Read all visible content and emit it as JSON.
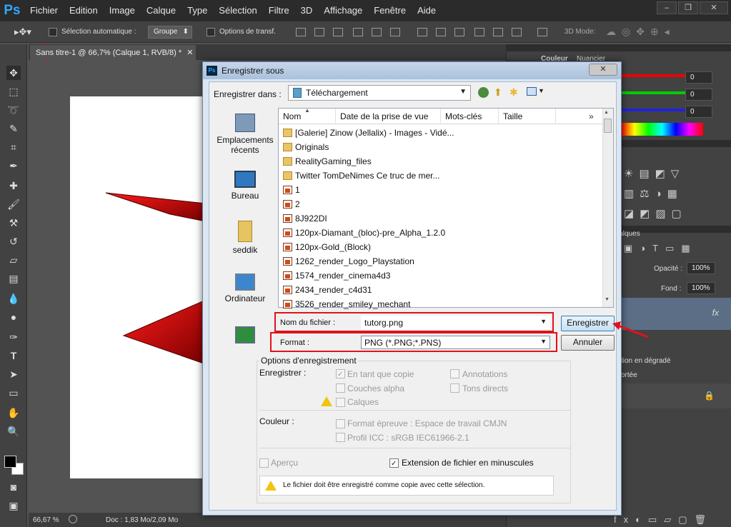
{
  "app": {
    "logo": "Ps"
  },
  "menu": [
    "Fichier",
    "Edition",
    "Image",
    "Calque",
    "Type",
    "Sélection",
    "Filtre",
    "3D",
    "Affichage",
    "Fenêtre",
    "Aide"
  ],
  "options": {
    "auto_select": "Sélection automatique :",
    "group": "Groupe",
    "transform": "Options de transf.",
    "mode3d": "3D Mode:"
  },
  "document": {
    "tab": "Sans titre-1 @ 66,7% (Calque 1, RVB/8) *",
    "zoom": "66,67 %",
    "doc_info": "Doc : 1,83 Mo/2,09 Mo"
  },
  "panels": {
    "color_tab": "Couleur",
    "swatches_tab": "Nuancier",
    "r": "0",
    "g": "0",
    "b": "0",
    "layers_tab": "Calques",
    "opacity_label": "Opacité :",
    "opacity_value": "100%",
    "fill_label": "Fond :",
    "fill_value": "100%",
    "fx": "fx",
    "effect1": "tion en dégradé",
    "effect2": "ortée"
  },
  "dialog": {
    "title": "Enregistrer sous",
    "save_in_label": "Enregistrer dans :",
    "save_in_value": "Téléchargement",
    "places": [
      "Emplacements récents",
      "Bureau",
      "seddik",
      "Ordinateur"
    ],
    "columns": [
      "Nom",
      "Date de la prise de vue",
      "Mots-clés",
      "Taille"
    ],
    "files": [
      {
        "name": "[Galerie] Zinow (Jellalix) - Images - Vidé...",
        "type": "folder"
      },
      {
        "name": "Originals",
        "type": "folder"
      },
      {
        "name": "RealityGaming_files",
        "type": "folder"
      },
      {
        "name": "Twitter   TomDeNimes   Ce truc de mer...",
        "type": "folder"
      },
      {
        "name": "1",
        "type": "img"
      },
      {
        "name": "2",
        "type": "img"
      },
      {
        "name": "8J922DI",
        "type": "img"
      },
      {
        "name": "120px-Diamant_(bloc)-pre_Alpha_1.2.0",
        "type": "img"
      },
      {
        "name": "120px-Gold_(Block)",
        "type": "img"
      },
      {
        "name": "1262_render_Logo_Playstation",
        "type": "img"
      },
      {
        "name": "1574_render_cinema4d3",
        "type": "img"
      },
      {
        "name": "2434_render_c4d31",
        "type": "img"
      },
      {
        "name": "3526_render_smiley_mechant",
        "type": "img"
      }
    ],
    "filename_label": "Nom du fichier :",
    "filename_value": "tutorg.png",
    "format_label": "Format :",
    "format_value": "PNG (*.PNG;*.PNS)",
    "save_button": "Enregistrer",
    "cancel_button": "Annuler",
    "options_title": "Options d'enregistrement",
    "save_label": "Enregistrer :",
    "opt_copy": "En tant que copie",
    "opt_alpha": "Couches alpha",
    "opt_layers": "Calques",
    "opt_notes": "Annotations",
    "opt_spot": "Tons directs",
    "color_label": "Couleur :",
    "opt_proof": "Format épreuve : Espace de travail CMJN",
    "opt_icc": "Profil ICC : sRGB IEC61966-2.1",
    "opt_preview": "Aperçu",
    "opt_lowercase": "Extension de fichier en minuscules",
    "warning": "Le fichier doit être enregistré comme copie avec cette sélection."
  },
  "colors": {
    "accent_red": "#e0121a",
    "ps_blue": "#31a8ff"
  }
}
